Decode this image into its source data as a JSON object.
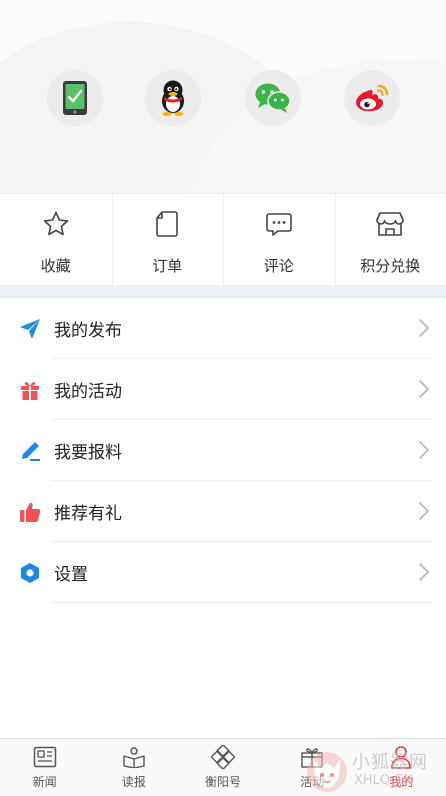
{
  "login": {
    "icons": [
      "phone-icon",
      "qq-icon",
      "wechat-icon",
      "weibo-icon"
    ]
  },
  "quick_actions": [
    {
      "label": "收藏",
      "icon": "star-icon"
    },
    {
      "label": "订单",
      "icon": "document-icon"
    },
    {
      "label": "评论",
      "icon": "comment-icon"
    },
    {
      "label": "积分兑换",
      "icon": "store-icon"
    }
  ],
  "menu": [
    {
      "label": "我的发布",
      "icon": "send-icon",
      "color": "#1e88e5"
    },
    {
      "label": "我的活动",
      "icon": "gift-icon",
      "color": "#f0525a"
    },
    {
      "label": "我要报料",
      "icon": "pen-icon",
      "color": "#1e88e5"
    },
    {
      "label": "推荐有礼",
      "icon": "thumbs-up-icon",
      "color": "#f0525a"
    },
    {
      "label": "设置",
      "icon": "settings-icon",
      "color": "#1e88e5"
    }
  ],
  "tabs": [
    {
      "label": "新闻",
      "icon": "news-icon"
    },
    {
      "label": "读报",
      "icon": "newspaper-icon"
    },
    {
      "label": "衡阳号",
      "icon": "diamond-icon"
    },
    {
      "label": "活动",
      "icon": "activity-icon"
    },
    {
      "label": "我的",
      "icon": "user-icon",
      "active": true
    }
  ],
  "colors": {
    "accent_blue": "#1e88e5",
    "accent_red": "#f0525a",
    "active_tab": "#e03a3a"
  },
  "watermark": {
    "text": "小狐器网",
    "sub": "XHLQ.CN"
  }
}
